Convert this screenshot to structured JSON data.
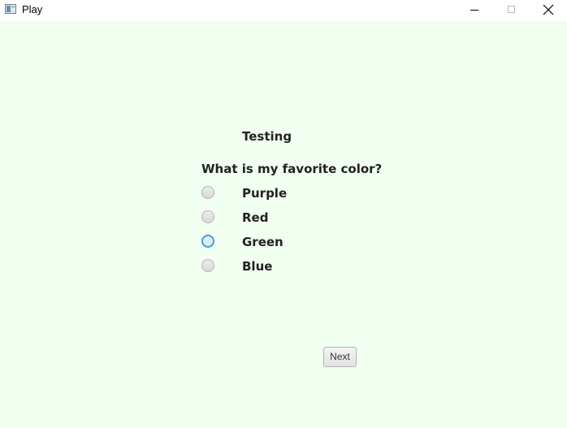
{
  "window": {
    "title": "Play",
    "icons": {
      "app": "app-icon",
      "minimize": "minimize-icon",
      "maximize": "maximize-icon",
      "close": "close-icon"
    }
  },
  "quiz": {
    "heading": "Testing",
    "question": "What is my favorite color?",
    "options": [
      {
        "label": "Purple",
        "focused": false
      },
      {
        "label": "Red",
        "focused": false
      },
      {
        "label": "Green",
        "focused": true
      },
      {
        "label": "Blue",
        "focused": false
      }
    ],
    "next_label": "Next"
  },
  "colors": {
    "background": "#f0fff0",
    "text": "#222222",
    "focus_ring": "#39a3d8"
  }
}
